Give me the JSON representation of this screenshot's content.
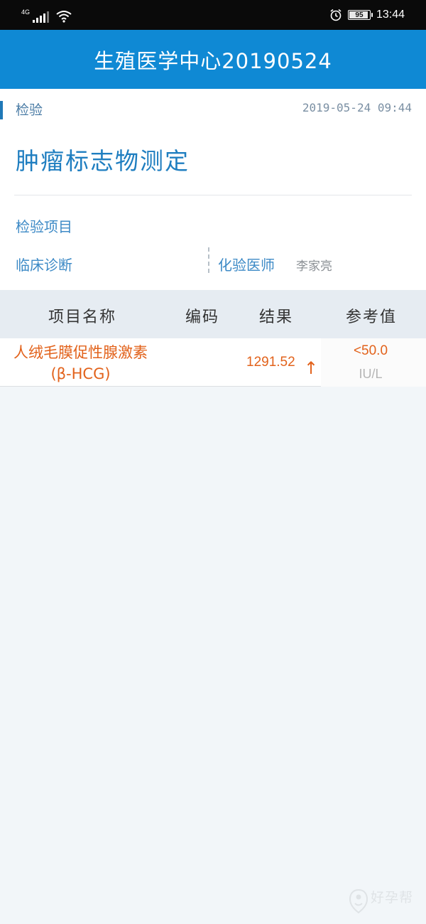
{
  "status_bar": {
    "network": "4G",
    "signal_bars": 4,
    "battery_level": 95,
    "battery_text": "95",
    "time": "13:44",
    "icons": [
      "signal-icon",
      "wifi-icon",
      "alarm-icon",
      "battery-icon"
    ]
  },
  "header": {
    "title": "生殖医学中心20190524"
  },
  "report": {
    "category": "检验",
    "datetime": "2019-05-24 09:44",
    "test_name": "肿瘤标志物测定",
    "items_label": "检验项目",
    "diagnosis_label": "临床诊断",
    "doctor_label": "化验医师",
    "doctor_name": "李家亮"
  },
  "table": {
    "headers": {
      "name": "项目名称",
      "code": "编码",
      "result": "结果",
      "reference": "参考值"
    },
    "rows": [
      {
        "name": "人绒毛膜促性腺激素(β-HCG)",
        "code": "",
        "result": "1291.52",
        "flag": "↑",
        "reference": "<50.0",
        "unit": "IU/L"
      }
    ]
  },
  "colors": {
    "header_bg": "#0f89d4",
    "accent_text": "#1f7ec0",
    "abnormal": "#e2621b",
    "page_bg": "#f2f6f9"
  },
  "watermark": {
    "text": "好孕帮",
    "icon": "pregnancy-logo-icon"
  }
}
